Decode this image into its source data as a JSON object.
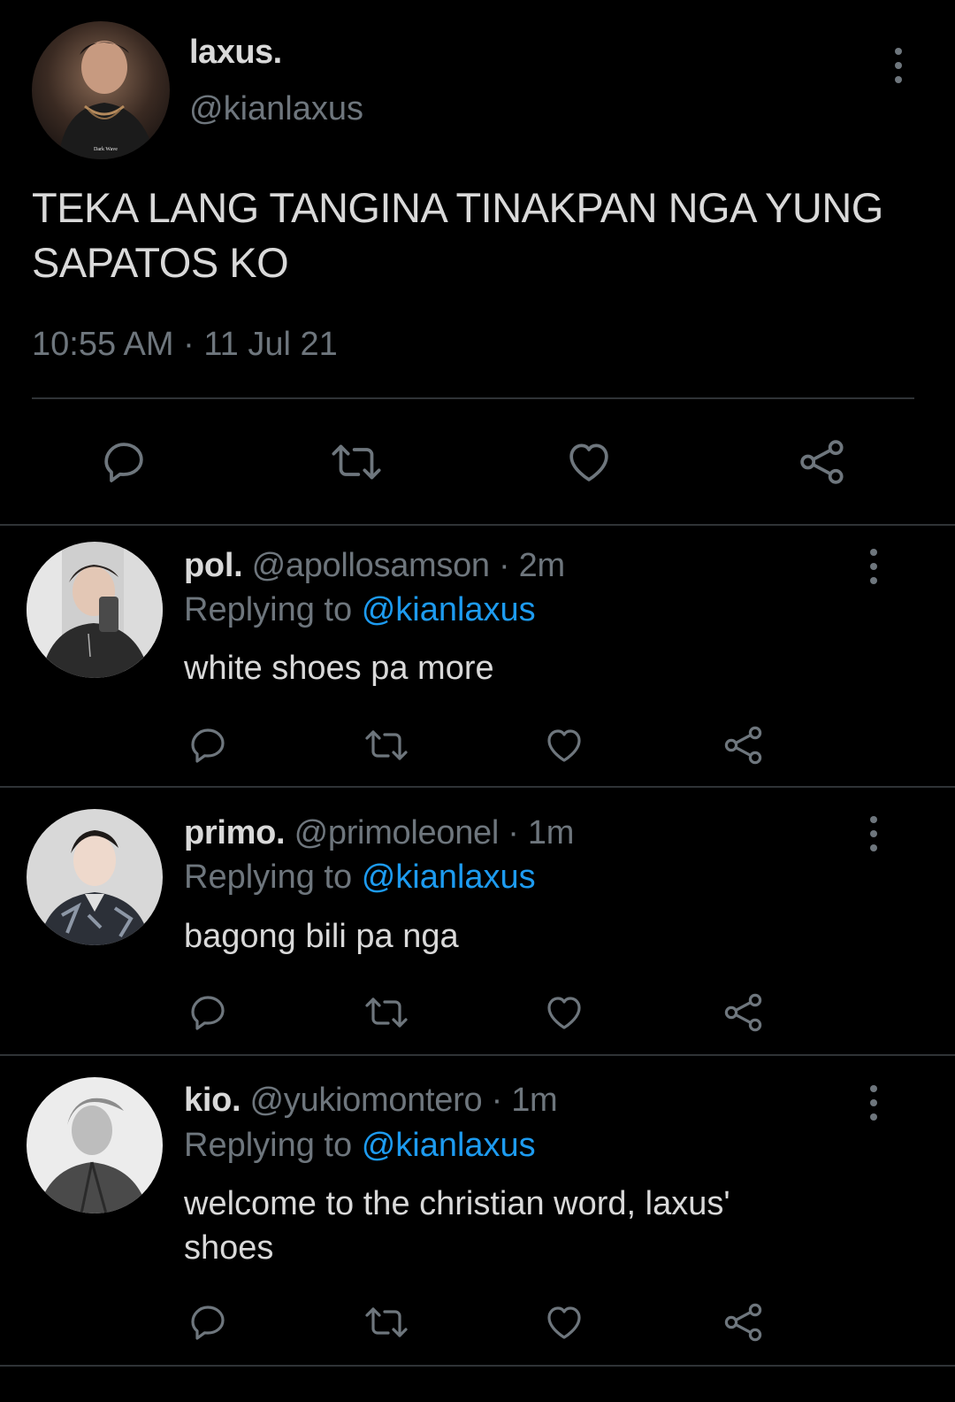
{
  "main_tweet": {
    "name": "laxus.",
    "handle": "@kianlaxus",
    "text": "TEKA LANG TANGINA TINAKPAN NGA YUNG SAPATOS KO",
    "timestamp": "10:55 AM · 11 Jul 21",
    "avatar_caption": "Dark Wave"
  },
  "icons": {
    "reply": "reply-icon",
    "retweet": "retweet-icon",
    "like": "heart-icon",
    "share": "share-icon",
    "more": "more-icon"
  },
  "colors": {
    "background": "#000000",
    "primary_text": "#d9d9d9",
    "secondary_text": "#6e767d",
    "mention": "#1d9bf0",
    "divider": "#2f3336"
  },
  "replies": [
    {
      "name": "pol.",
      "handle": "@apollosamson",
      "dot": "·",
      "time": "2m",
      "replying_prefix": "Replying to",
      "replying_handle": "@kianlaxus",
      "text": "white shoes pa more"
    },
    {
      "name": "primo.",
      "handle": "@primoleonel",
      "dot": "·",
      "time": "1m",
      "replying_prefix": "Replying to",
      "replying_handle": "@kianlaxus",
      "text": "bagong bili pa nga"
    },
    {
      "name": "kio.",
      "handle": "@yukiomontero",
      "dot": "·",
      "time": "1m",
      "replying_prefix": "Replying to",
      "replying_handle": "@kianlaxus",
      "text": "welcome to the christian word, laxus' shoes"
    }
  ]
}
